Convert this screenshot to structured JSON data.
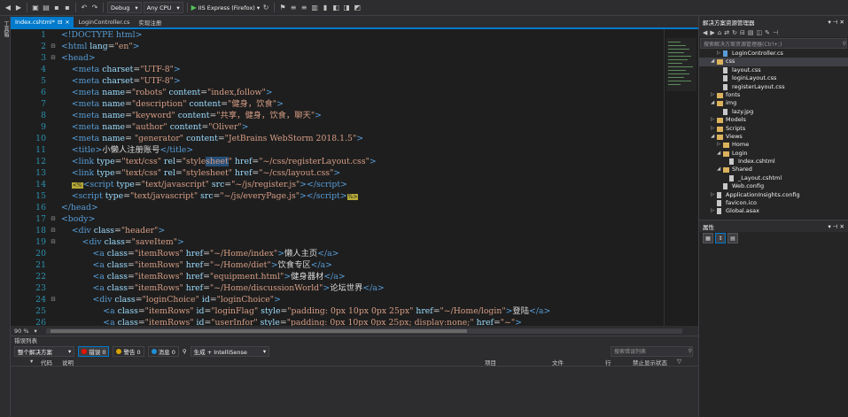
{
  "toolbar": {
    "config": "Debug",
    "platform": "Any CPU",
    "run_target": "IIS Express (Firefox)"
  },
  "left_strip": {
    "label": "工具箱"
  },
  "tabs": [
    {
      "label": "Index.cshtml*",
      "active": true
    },
    {
      "label": "LoginController.cs",
      "active": false
    },
    {
      "label": "实现注册",
      "active": false
    }
  ],
  "editor": {
    "lines": [
      {
        "n": "1"
      },
      {
        "n": "2"
      },
      {
        "n": "3"
      },
      {
        "n": "4"
      },
      {
        "n": "5"
      },
      {
        "n": "6"
      },
      {
        "n": "7"
      },
      {
        "n": "8"
      },
      {
        "n": "9"
      },
      {
        "n": "10"
      },
      {
        "n": "11"
      },
      {
        "n": "12"
      },
      {
        "n": "13"
      },
      {
        "n": "14"
      },
      {
        "n": "15"
      },
      {
        "n": "16"
      },
      {
        "n": "17"
      },
      {
        "n": "18"
      },
      {
        "n": "19"
      },
      {
        "n": "20"
      },
      {
        "n": "21"
      },
      {
        "n": "22"
      },
      {
        "n": "23"
      },
      {
        "n": "24"
      },
      {
        "n": "25"
      },
      {
        "n": "26"
      }
    ],
    "text": {
      "doctype": "!DOCTYPE html",
      "html_tag": "html",
      "lang_attr": "lang",
      "lang_val": "\"en\"",
      "head": "head",
      "meta": "meta",
      "charset": "charset",
      "utf8": "\"UTF-8\"",
      "name": "name",
      "content": "content",
      "robots": "\"robots\"",
      "robots_c": "\"index,follow\"",
      "description": "\"description\"",
      "description_c": "\"健身，饮食\"",
      "keyword": "\"keyword\"",
      "keyword_c": "\"共享，健身，饮食，聊天\"",
      "author": "\"author\"",
      "author_c": "\"Oliver\"",
      "generator": "\"generator\"",
      "generator_c": "\"JetBrains WebStorm 2018.1.5\"",
      "title_tag": "title",
      "title_text": "小懒人注册账号",
      "link": "link",
      "type": "type",
      "textcss": "\"text/css\"",
      "rel": "rel",
      "style_pre": "\"style",
      "style_sel": "sheet",
      "style_post": "\"",
      "stylesheet": "\"stylesheet\"",
      "href": "href",
      "reg_css": "\"~/css/registerLayout.css\"",
      "layout_css": "\"~/css/layout.css\"",
      "script": "script",
      "textjs": "\"text/javascript\"",
      "src": "src",
      "reg_js": "\"~/js/register.js\"",
      "every_js": "\"~/js/everyPage.js\"",
      "body": "body",
      "div": "div",
      "class": "class",
      "header_c": "\"header\"",
      "saveitem_c": "\"saveItem\"",
      "a": "a",
      "itemrows": "\"itemRows\"",
      "home_href": "\"~/Home/index\"",
      "home_text": "懒人主页",
      "diet_href": "\"~/Home/diet\"",
      "diet_text": "饮食专区",
      "equip_href": "\"equipment.html\"",
      "equip_text": "健身器材",
      "disc_href": "\"~/Home/discussionWorld\"",
      "disc_text": "论坛世界",
      "loginchoice": "\"loginChoice\"",
      "id": "id",
      "loginflag": "\"loginFlag\"",
      "style": "style",
      "padding": "\"padding: 0px 10px 0px 25px\"",
      "login_href": "\"~/Home/login\"",
      "login_text": "登陆",
      "userinfor": "\"userInfor\"",
      "padding2": "\"padding: 0px 10px 0px 25px; display:none;\"",
      "href_tilde": "\"~\"",
      "mark": "<%",
      "close_mark": "%>"
    }
  },
  "zoom": "90 %",
  "error_list": {
    "title": "错误列表",
    "scope": "整个解决方案",
    "errors": "错误 0",
    "warnings": "警告 0",
    "messages": "消息 0",
    "build": "生成 + IntelliSense",
    "search_placeholder": "搜索错误列表",
    "columns": {
      "code": "代码",
      "desc": "说明",
      "project": "项目",
      "file": "文件",
      "line": "行",
      "suppress": "禁止显示状态"
    }
  },
  "solution": {
    "title": "解决方案资源管理器",
    "search_placeholder": "搜索解决方案资源管理器(Ctrl+;)",
    "items": [
      {
        "label": "LoginController.cs",
        "indent": 3,
        "arrow": "right",
        "icon": "cs"
      },
      {
        "label": "css",
        "indent": 2,
        "arrow": "down",
        "icon": "folder",
        "selected": true
      },
      {
        "label": "layout.css",
        "indent": 3,
        "arrow": "",
        "icon": "file"
      },
      {
        "label": "loginLayout.css",
        "indent": 3,
        "arrow": "",
        "icon": "file"
      },
      {
        "label": "registerLayout.css",
        "indent": 3,
        "arrow": "",
        "icon": "file"
      },
      {
        "label": "fonts",
        "indent": 2,
        "arrow": "right",
        "icon": "folder"
      },
      {
        "label": "img",
        "indent": 2,
        "arrow": "down",
        "icon": "folder"
      },
      {
        "label": "lazy.jpg",
        "indent": 3,
        "arrow": "",
        "icon": "file"
      },
      {
        "label": "Models",
        "indent": 2,
        "arrow": "right",
        "icon": "folder"
      },
      {
        "label": "Scripts",
        "indent": 2,
        "arrow": "right",
        "icon": "folder"
      },
      {
        "label": "Views",
        "indent": 2,
        "arrow": "down",
        "icon": "folder"
      },
      {
        "label": "Home",
        "indent": 3,
        "arrow": "right",
        "icon": "folder"
      },
      {
        "label": "Login",
        "indent": 3,
        "arrow": "down",
        "icon": "folder"
      },
      {
        "label": "Index.cshtml",
        "indent": 4,
        "arrow": "",
        "icon": "file"
      },
      {
        "label": "Shared",
        "indent": 3,
        "arrow": "down",
        "icon": "folder"
      },
      {
        "label": "_Layout.cshtml",
        "indent": 4,
        "arrow": "",
        "icon": "file"
      },
      {
        "label": "Web.config",
        "indent": 3,
        "arrow": "",
        "icon": "file"
      },
      {
        "label": "ApplicationInsights.config",
        "indent": 2,
        "arrow": "right",
        "icon": "file"
      },
      {
        "label": "favicon.ico",
        "indent": 2,
        "arrow": "",
        "icon": "file"
      },
      {
        "label": "Global.asax",
        "indent": 2,
        "arrow": "right",
        "icon": "file"
      }
    ]
  },
  "properties": {
    "title": "属性"
  },
  "colors": {
    "accent": "#007acc",
    "bg": "#2d2d30",
    "editor_bg": "#1e1e1e"
  }
}
